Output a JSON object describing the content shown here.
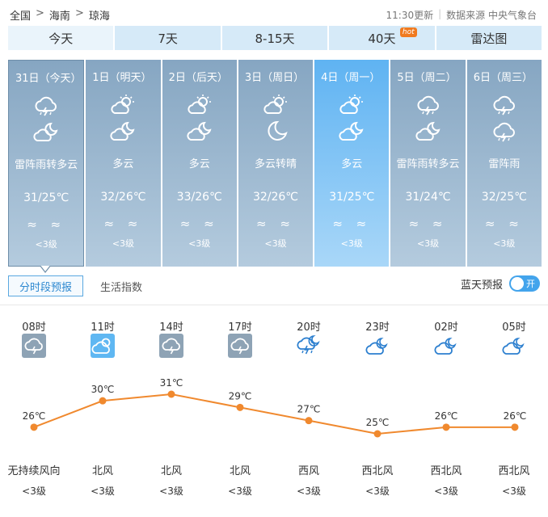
{
  "breadcrumb": {
    "items": [
      "全国",
      "海南",
      "琼海"
    ],
    "sep": ">"
  },
  "meta": {
    "updated": "11:30更新",
    "source": "数据来源 中央气象台"
  },
  "tabs": [
    {
      "label": "今天"
    },
    {
      "label": "7天"
    },
    {
      "label": "8-15天"
    },
    {
      "label": "40天",
      "badge": "hot"
    },
    {
      "label": "雷达图"
    }
  ],
  "days": [
    {
      "date": "31日（今天）",
      "icon1": "thunderstorm-icon",
      "icon2": "partly-cloudy-night-icon",
      "desc": "雷阵雨转多云",
      "temp": "31/25℃",
      "wind": "≈ ≈",
      "level": "<3级"
    },
    {
      "date": "1日（明天）",
      "icon1": "partly-cloudy-icon",
      "icon2": "partly-cloudy-night-icon",
      "desc": "多云",
      "temp": "32/26℃",
      "wind": "≈ ≈",
      "level": "<3级"
    },
    {
      "date": "2日（后天）",
      "icon1": "partly-cloudy-icon",
      "icon2": "partly-cloudy-night-icon",
      "desc": "多云",
      "temp": "33/26℃",
      "wind": "≈ ≈",
      "level": "<3级"
    },
    {
      "date": "3日（周日）",
      "icon1": "partly-cloudy-icon",
      "icon2": "moon-icon",
      "desc": "多云转晴",
      "temp": "32/26℃",
      "wind": "≈ ≈",
      "level": "<3级"
    },
    {
      "date": "4日（周一）",
      "icon1": "partly-cloudy-icon",
      "icon2": "partly-cloudy-night-icon",
      "desc": "多云",
      "temp": "31/25℃",
      "wind": "≈ ≈",
      "level": "<3级"
    },
    {
      "date": "5日（周二）",
      "icon1": "thunderstorm-icon",
      "icon2": "partly-cloudy-night-icon",
      "desc": "雷阵雨转多云",
      "temp": "31/24℃",
      "wind": "≈ ≈",
      "level": "<3级"
    },
    {
      "date": "6日（周三）",
      "icon1": "thunderstorm-icon",
      "icon2": "thunderstorm-icon",
      "desc": "雷阵雨",
      "temp": "32/25℃",
      "wind": "≈ ≈",
      "level": "<3级"
    }
  ],
  "subtabs": {
    "hourly": "分时段预报",
    "life": "生活指数"
  },
  "bluesky": {
    "label": "蓝天预报",
    "state": "开"
  },
  "hourly": [
    {
      "time": "08时",
      "icon": "thunderstorm-icon",
      "temp": 26,
      "temp_label": "26℃",
      "wind_dir": "无持续风向",
      "wind_level": "<3级"
    },
    {
      "time": "11时",
      "icon": "partly-cloudy-icon",
      "temp": 30,
      "temp_label": "30℃",
      "wind_dir": "北风",
      "wind_level": "<3级"
    },
    {
      "time": "14时",
      "icon": "thunderstorm-icon",
      "temp": 31,
      "temp_label": "31℃",
      "wind_dir": "北风",
      "wind_level": "<3级"
    },
    {
      "time": "17时",
      "icon": "thunderstorm-icon",
      "temp": 29,
      "temp_label": "29℃",
      "wind_dir": "北风",
      "wind_level": "<3级"
    },
    {
      "time": "20时",
      "icon": "thunderstorm-night-icon",
      "temp": 27,
      "temp_label": "27℃",
      "wind_dir": "西风",
      "wind_level": "<3级"
    },
    {
      "time": "23时",
      "icon": "partly-cloudy-night-icon",
      "temp": 25,
      "temp_label": "25℃",
      "wind_dir": "西北风",
      "wind_level": "<3级"
    },
    {
      "time": "02时",
      "icon": "partly-cloudy-night-icon",
      "temp": 26,
      "temp_label": "26℃",
      "wind_dir": "西北风",
      "wind_level": "<3级"
    },
    {
      "time": "05时",
      "icon": "partly-cloudy-night-icon",
      "temp": 26,
      "temp_label": "26℃",
      "wind_dir": "西北风",
      "wind_level": "<3级"
    }
  ],
  "colors": {
    "accent": "#43a4ec",
    "line": "#f0892e",
    "card": "#9ab6cf",
    "card_highlight": "#6fbcf4"
  }
}
